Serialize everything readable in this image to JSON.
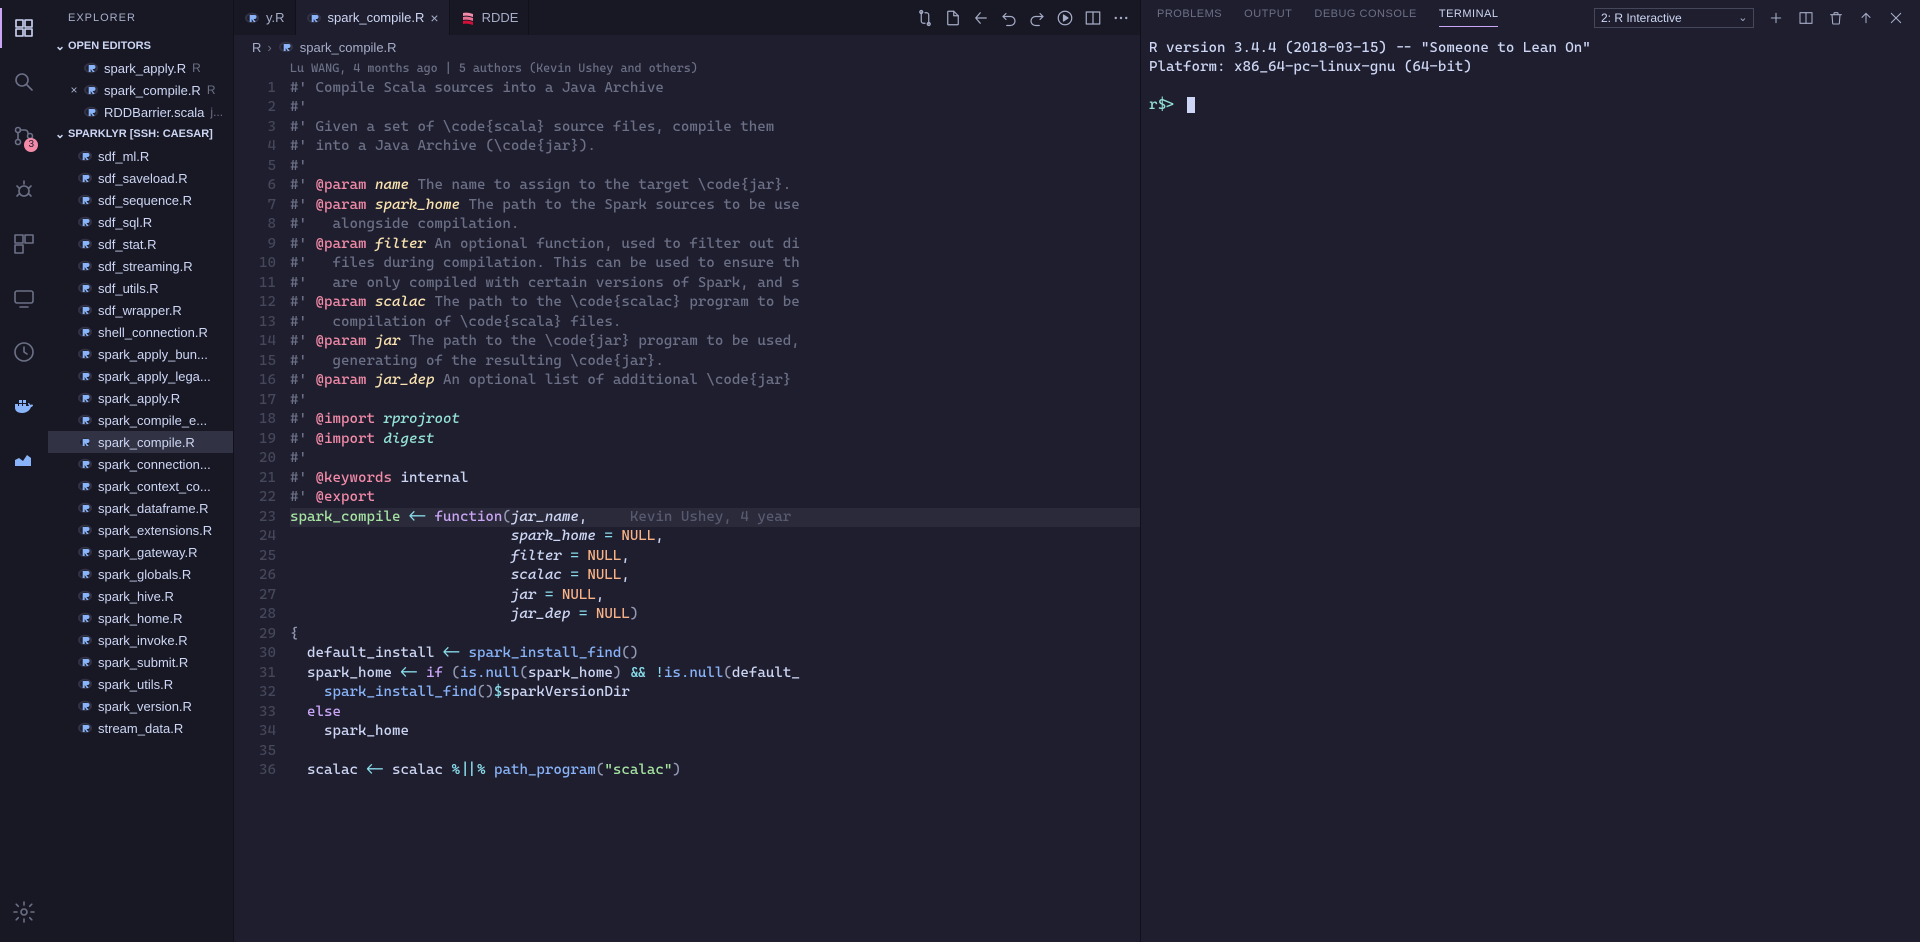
{
  "activitybar": {
    "scm_badge": "3"
  },
  "explorer": {
    "title": "EXPLORER",
    "open_editors_label": "OPEN EDITORS",
    "open_editors": [
      {
        "name": "spark_apply.R",
        "suffix": "R"
      },
      {
        "name": "spark_compile.R",
        "suffix": "R",
        "close": true
      },
      {
        "name": "RDDBarrier.scala",
        "suffix": "j..."
      }
    ],
    "workspace_label": "SPARKLYR [SSH: CAESAR]",
    "files": [
      "sdf_ml.R",
      "sdf_saveload.R",
      "sdf_sequence.R",
      "sdf_sql.R",
      "sdf_stat.R",
      "sdf_streaming.R",
      "sdf_utils.R",
      "sdf_wrapper.R",
      "shell_connection.R",
      "spark_apply_bun...",
      "spark_apply_lega...",
      "spark_apply.R",
      "spark_compile_e...",
      "spark_compile.R",
      "spark_connection...",
      "spark_context_co...",
      "spark_dataframe.R",
      "spark_extensions.R",
      "spark_gateway.R",
      "spark_globals.R",
      "spark_hive.R",
      "spark_home.R",
      "spark_invoke.R",
      "spark_submit.R",
      "spark_utils.R",
      "spark_version.R",
      "stream_data.R"
    ],
    "selected_index": 13
  },
  "tabs": [
    {
      "label": "y.R"
    },
    {
      "label": "spark_compile.R",
      "active": true
    },
    {
      "label": "RDDE"
    }
  ],
  "breadcrumb": {
    "folder": "R",
    "file": "spark_compile.R"
  },
  "codelens": "Lu WANG, 4 months ago | 5 authors (Kevin Ushey and others)",
  "inline_blame": "Kevin Ushey, 4 year",
  "code": {
    "l1": "#' Compile Scala sources into a Java Archive",
    "l2": "#'",
    "l3": "#' Given a set of \\code{scala} source files, compile them",
    "l4": "#' into a Java Archive (\\code{jar}).",
    "l5": "#'",
    "l6": {
      "pre": "#' ",
      "tag": "@param",
      "name": "name",
      "rest": " The name to assign to the target \\code{jar}."
    },
    "l7": {
      "pre": "#' ",
      "tag": "@param",
      "name": "spark_home",
      "rest": " The path to the Spark sources to be use"
    },
    "l8": "#'   alongside compilation.",
    "l9": {
      "pre": "#' ",
      "tag": "@param",
      "name": "filter",
      "rest": " An optional function, used to filter out di"
    },
    "l10": "#'   files during compilation. This can be used to ensure th",
    "l11": "#'   are only compiled with certain versions of Spark, and s",
    "l12": {
      "pre": "#' ",
      "tag": "@param",
      "name": "scalac",
      "rest": " The path to the \\code{scalac} program to be"
    },
    "l13": "#'   compilation of \\code{scala} files.",
    "l14": {
      "pre": "#' ",
      "tag": "@param",
      "name": "jar",
      "rest": " The path to the \\code{jar} program to be used,"
    },
    "l15": "#'   generating of the resulting \\code{jar}.",
    "l16": {
      "pre": "#' ",
      "tag": "@param",
      "name": "jar_dep",
      "rest": " An optional list of additional \\code{jar}"
    },
    "l17": "#'",
    "l18": {
      "pre": "#' ",
      "tag": "@import",
      "name": "rprojroot"
    },
    "l19": {
      "pre": "#' ",
      "tag": "@import",
      "name": "digest"
    },
    "l20": "#'",
    "l21": {
      "pre": "#' ",
      "tag": "@keywords",
      "rest": "internal"
    },
    "l22": {
      "pre": "#' ",
      "tag": "@export"
    },
    "l23": {
      "fn": "spark_compile",
      "arg1": "jar_name"
    },
    "l24": {
      "arg": "spark_home"
    },
    "l25": {
      "arg": "filter"
    },
    "l26": {
      "arg": "scalac"
    },
    "l27": {
      "arg": "jar"
    },
    "l28": {
      "arg": "jar_dep"
    },
    "l30a": "default_install",
    "l30b": "spark_install_find",
    "l31": {
      "a": "spark_home",
      "cond1": "is.null",
      "p1": "spark_home",
      "cond2": "is.null",
      "p2": "default_"
    },
    "l32a": "spark_install_find",
    "l32b": "sparkVersionDir",
    "l34": "spark_home",
    "l36": {
      "a": "scalac",
      "b": "scalac",
      "fn": "path_program",
      "str": "\"scalac\""
    }
  },
  "terminal": {
    "panel_tabs": [
      "PROBLEMS",
      "OUTPUT",
      "DEBUG CONSOLE",
      "TERMINAL"
    ],
    "active_tab": 3,
    "select_label": "2: R Interactive",
    "lines": [
      "R version 3.4.4 (2018-03-15) -- \"Someone to Lean On\"",
      "Platform: x86_64-pc-linux-gnu (64-bit)",
      "",
      "r$> "
    ]
  }
}
